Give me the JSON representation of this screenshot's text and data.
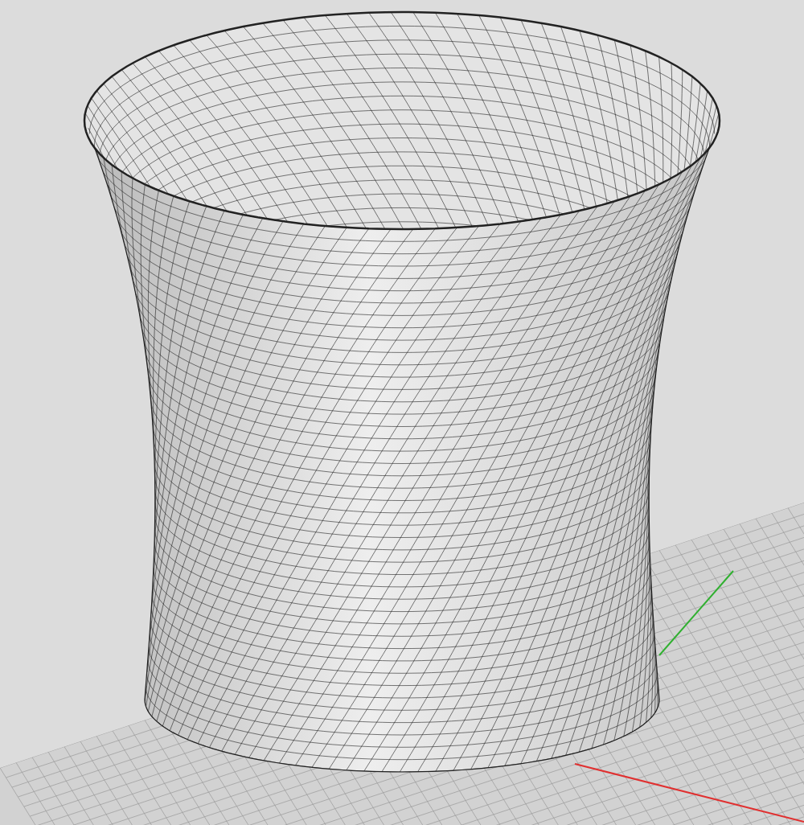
{
  "viewport": {
    "grid_visible": true,
    "axes": [
      {
        "kind": "x",
        "color": "#e03030"
      },
      {
        "kind": "y",
        "color": "#30b030"
      }
    ]
  }
}
